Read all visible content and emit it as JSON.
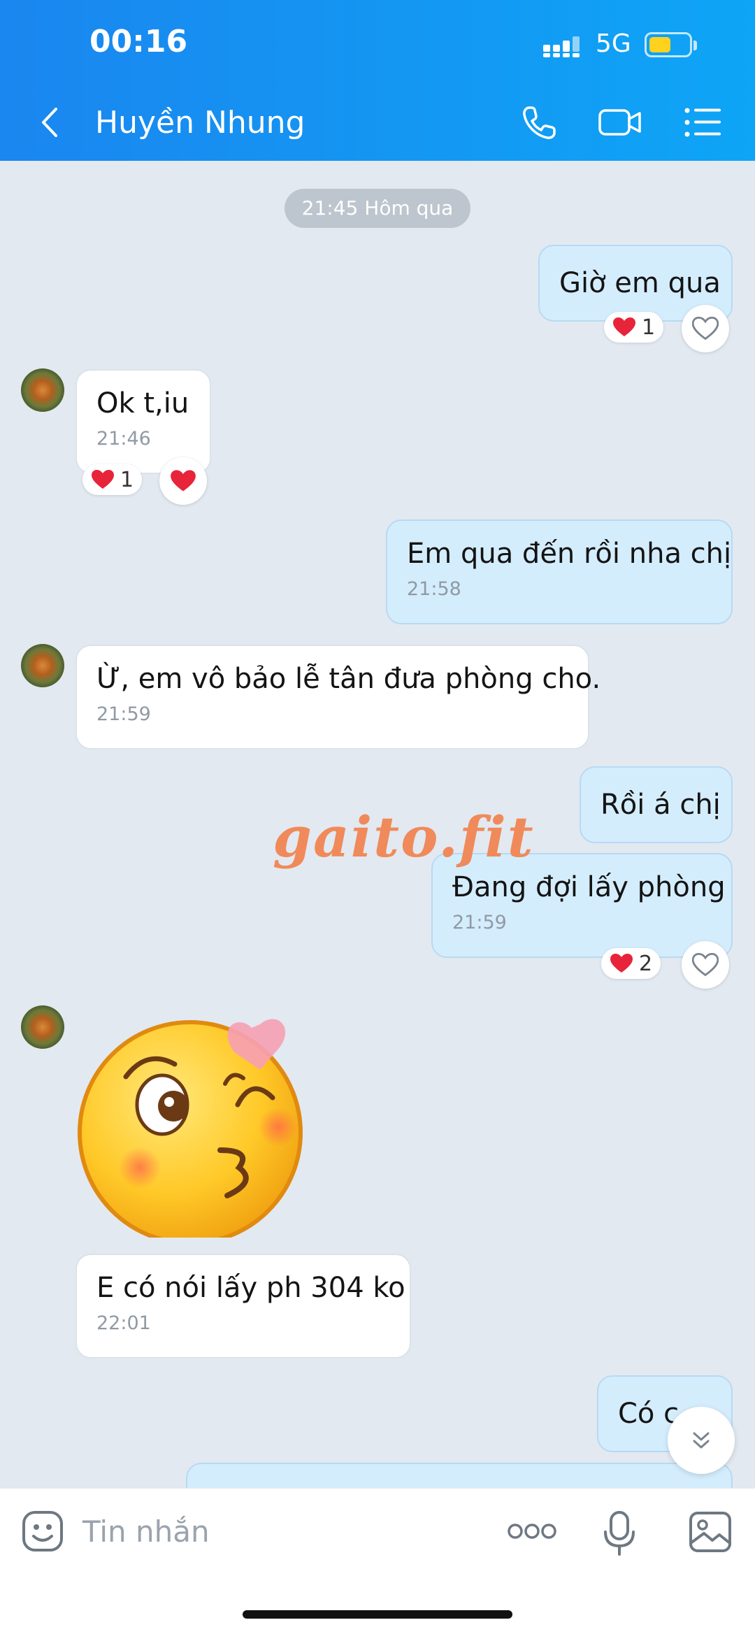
{
  "status_bar": {
    "time": "00:16",
    "network": "5G"
  },
  "header": {
    "contact_name": "Huyền Nhung"
  },
  "chat": {
    "date_separator": "21:45 Hôm qua",
    "messages": [
      {
        "direction": "out",
        "text": "Giờ em qua",
        "reactions": {
          "count": "1"
        }
      },
      {
        "direction": "in",
        "text": "Ok t,iu",
        "time": "21:46",
        "reactions": {
          "count": "1"
        }
      },
      {
        "direction": "out",
        "text": "Em qua đến rồi nha chị",
        "time": "21:58"
      },
      {
        "direction": "in",
        "text": "Ừ, em vô bảo lễ tân đưa phòng cho.",
        "time": "21:59"
      },
      {
        "direction": "out",
        "text": "Rồi á chị"
      },
      {
        "direction": "out",
        "text": "Đang đợi lấy phòng",
        "time": "21:59",
        "reactions": {
          "count": "2"
        }
      },
      {
        "direction": "in",
        "type": "sticker",
        "sticker": "kiss-face-heart"
      },
      {
        "direction": "in",
        "text": "E có nói lấy ph 304 ko",
        "time": "22:01"
      },
      {
        "direction": "out",
        "text": "Có c"
      }
    ],
    "watermark": "gaito.fit"
  },
  "composer": {
    "placeholder": "Tin nhắn"
  },
  "icons": {
    "back": "chevron-left-icon",
    "call": "phone-icon",
    "video": "video-camera-icon",
    "menu": "list-menu-icon",
    "sticker": "smiley-icon",
    "more": "more-dots-icon",
    "mic": "mic-icon",
    "image": "image-icon",
    "scroll": "chevron-down-icon"
  },
  "colors": {
    "header_blue": "#1a86ef",
    "outgoing_bubble": "#d4edfd",
    "background": "#e2e9f1",
    "heart": "#e8243a"
  }
}
